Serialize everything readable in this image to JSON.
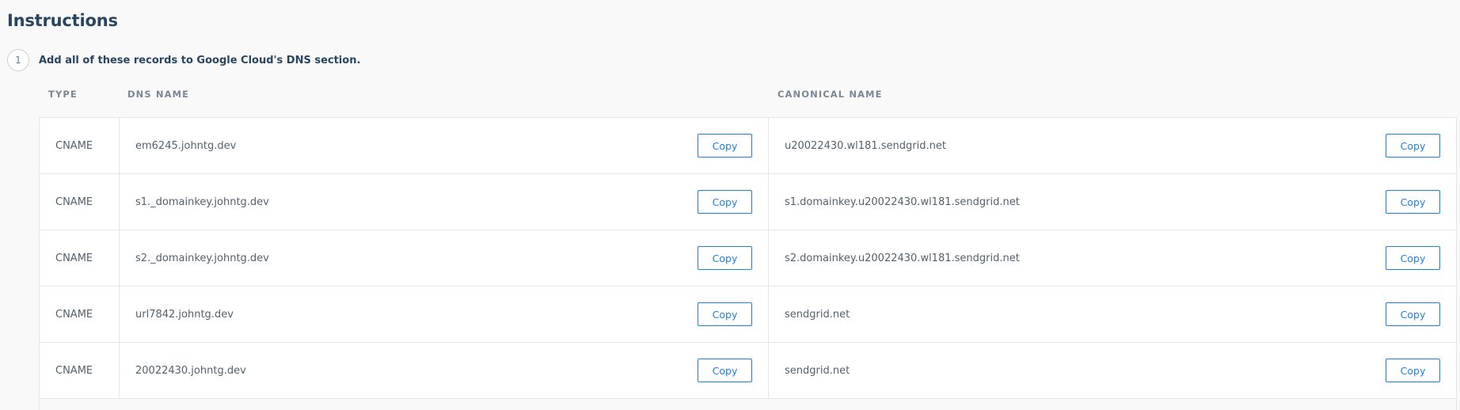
{
  "instructions": {
    "title": "Instructions",
    "step_number": "1",
    "step_text": "Add all of these records to Google Cloud's DNS section."
  },
  "table": {
    "headers": {
      "type": "TYPE",
      "dns_name": "DNS NAME",
      "canonical_name": "CANONICAL NAME"
    },
    "rows": [
      {
        "type": "CNAME",
        "dns_name": "em6245.johntg.dev",
        "canonical_name": "u20022430.wl181.sendgrid.net",
        "copy_label": "Copy"
      },
      {
        "type": "CNAME",
        "dns_name": "s1._domainkey.johntg.dev",
        "canonical_name": "s1.domainkey.u20022430.wl181.sendgrid.net",
        "copy_label": "Copy"
      },
      {
        "type": "CNAME",
        "dns_name": "s2._domainkey.johntg.dev",
        "canonical_name": "s2.domainkey.u20022430.wl181.sendgrid.net",
        "copy_label": "Copy"
      },
      {
        "type": "CNAME",
        "dns_name": "url7842.johntg.dev",
        "canonical_name": "sendgrid.net",
        "copy_label": "Copy"
      },
      {
        "type": "CNAME",
        "dns_name": "20022430.johntg.dev",
        "canonical_name": "sendgrid.net",
        "copy_label": "Copy"
      }
    ]
  },
  "colors": {
    "accent": "#1a82e2",
    "heading": "#294661",
    "muted": "#7b8794"
  }
}
